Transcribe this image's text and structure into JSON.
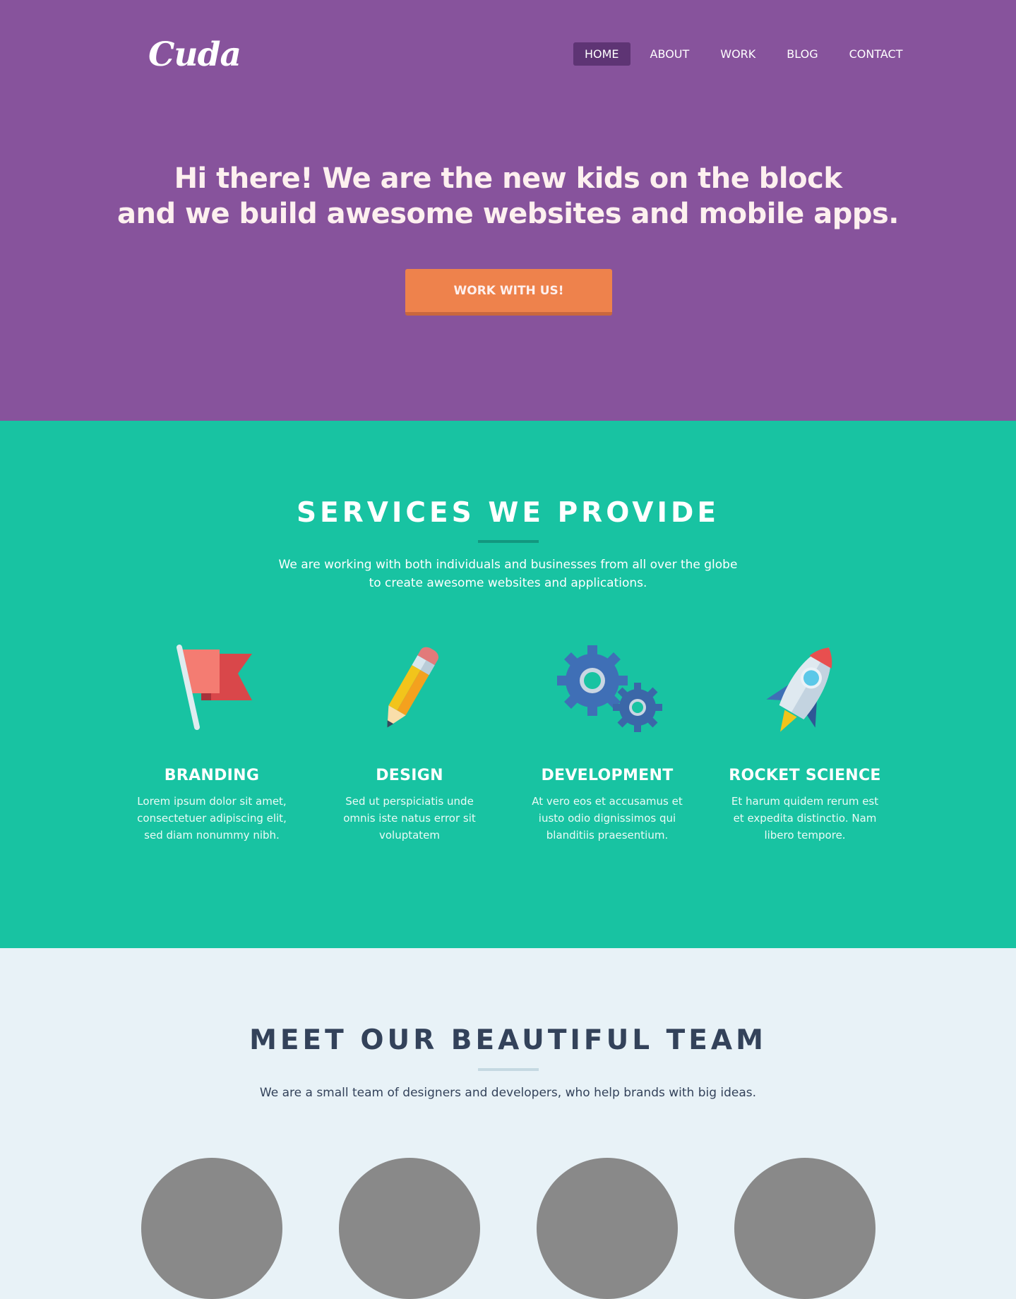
{
  "header": {
    "logo": "Cuda",
    "nav": [
      {
        "label": "HOME",
        "active": true
      },
      {
        "label": "ABOUT",
        "active": false
      },
      {
        "label": "WORK",
        "active": false
      },
      {
        "label": "BLOG",
        "active": false
      },
      {
        "label": "CONTACT",
        "active": false
      }
    ]
  },
  "hero": {
    "headline_line1": "Hi there! We are the new kids on the block",
    "headline_line2": "and we build awesome websites and mobile apps.",
    "cta_label": "WORK WITH US!"
  },
  "services": {
    "title": "SERVICES WE PROVIDE",
    "lead_line1": "We are working with both individuals and businesses from all over the globe",
    "lead_line2": "to create awesome websites and applications.",
    "items": [
      {
        "icon": "flag-icon",
        "title": "BRANDING",
        "line1": "Lorem ipsum dolor sit amet,",
        "line2": "consectetuer adipiscing elit,",
        "line3": "sed diam nonummy nibh."
      },
      {
        "icon": "pencil-icon",
        "title": "DESIGN",
        "line1": "Sed ut perspiciatis unde",
        "line2": "omnis iste natus error sit",
        "line3": "voluptatem"
      },
      {
        "icon": "gears-icon",
        "title": "DEVELOPMENT",
        "line1": "At vero eos et accusamus et",
        "line2": "iusto odio dignissimos qui",
        "line3": "blanditiis praesentium."
      },
      {
        "icon": "rocket-icon",
        "title": "ROCKET SCIENCE",
        "line1": "Et harum quidem rerum est",
        "line2": "et expedita distinctio. Nam",
        "line3": "libero tempore."
      }
    ]
  },
  "team": {
    "title": "MEET OUR BEAUTIFUL TEAM",
    "lead": "We are a small team of designers and developers, who help brands with big ideas."
  },
  "colors": {
    "hero_bg": "#87539c",
    "services_bg": "#18c3a2",
    "team_bg": "#e8f2f7",
    "cta": "#ee824c",
    "nav_active": "#5e3474",
    "avatar_placeholder": "#898989"
  }
}
